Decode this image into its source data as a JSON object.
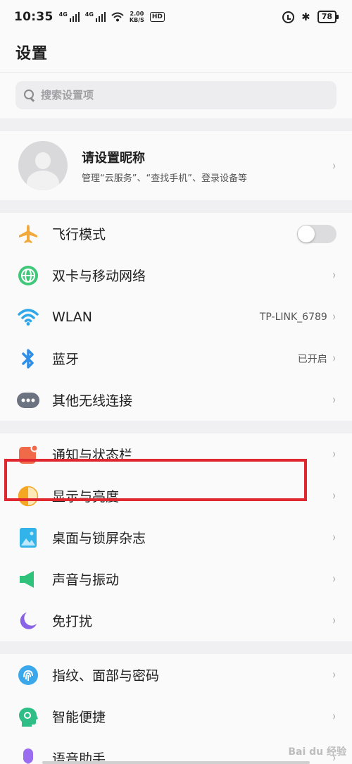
{
  "status_bar": {
    "time": "10:35",
    "network_1": "4G",
    "network_2": "4G",
    "speed_value": "2.00",
    "speed_unit": "KB/S",
    "hd": "HD",
    "bluetooth": "✱",
    "battery": "78"
  },
  "header": {
    "title": "设置"
  },
  "search": {
    "placeholder": "搜索设置项"
  },
  "profile": {
    "name": "请设置昵称",
    "description": "管理“云服务”、“查找手机”、登录设备等"
  },
  "chevron": "›",
  "group1": [
    {
      "label": "飞行模式",
      "value": "",
      "icon": "airplane-icon",
      "toggle": false
    },
    {
      "label": "双卡与移动网络",
      "value": "",
      "icon": "globe-icon"
    },
    {
      "label": "WLAN",
      "value": "TP-LINK_6789",
      "icon": "wifi-icon"
    },
    {
      "label": "蓝牙",
      "value": "已开启",
      "icon": "bluetooth-icon"
    },
    {
      "label": "其他无线连接",
      "value": "",
      "icon": "more-dots-icon"
    }
  ],
  "group2": [
    {
      "label": "通知与状态栏",
      "value": "",
      "icon": "notification-icon"
    },
    {
      "label": "显示与亮度",
      "value": "",
      "icon": "brightness-icon"
    },
    {
      "label": "桌面与锁屏杂志",
      "value": "",
      "icon": "wallpaper-icon"
    },
    {
      "label": "声音与振动",
      "value": "",
      "icon": "speaker-icon"
    },
    {
      "label": "免打扰",
      "value": "",
      "icon": "moon-icon"
    }
  ],
  "group3": [
    {
      "label": "指纹、面部与密码",
      "value": "",
      "icon": "fingerprint-icon"
    },
    {
      "label": "智能便捷",
      "value": "",
      "icon": "smart-head-icon"
    },
    {
      "label": "语音助手",
      "value": "",
      "icon": "microphone-icon"
    }
  ],
  "watermark": "Bai du 经验",
  "colors": {
    "airplane": "#f2a93b",
    "globe": "#3fc77a",
    "wifi": "#2fa7e8",
    "bluetooth": "#2f8fe8",
    "dots": "#6b7280",
    "notification": "#f06a4a",
    "brightness": "#f5a623",
    "wallpaper": "#32b4ea",
    "speaker": "#2fc27a",
    "moon": "#8a62e6",
    "fingerprint": "#3aa8ea",
    "smart": "#2fbf86",
    "mic": "#9a6cf0",
    "highlight": "#e0262f"
  }
}
